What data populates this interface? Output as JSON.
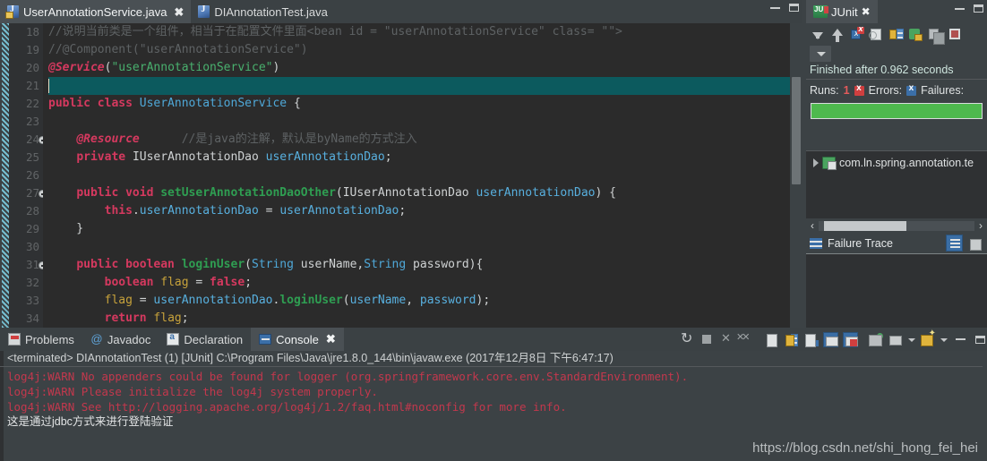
{
  "editor": {
    "tabs": [
      {
        "label": "UserAnnotationService.java",
        "active": true,
        "closeable": true,
        "icon": "java-file-lock-icon"
      },
      {
        "label": "DIAnnotationTest.java",
        "active": false,
        "closeable": false,
        "icon": "java-file-icon"
      }
    ],
    "window_controls": {
      "minimize": "minimize-icon",
      "maximize": "maximize-icon"
    },
    "first_line_number": 18,
    "lines": [
      {
        "n": 18,
        "fold": false,
        "tokens": [
          {
            "t": "//说明当前类是一个组件，相当于在配置文件里面<bean id = \"userAnnotationService\" class= \"\">",
            "c": "cmt"
          }
        ]
      },
      {
        "n": 19,
        "fold": false,
        "tokens": [
          {
            "t": "//@Component(\"userAnnotationService\")",
            "c": "cmt"
          }
        ]
      },
      {
        "n": 20,
        "fold": false,
        "tokens": [
          {
            "t": "@Service",
            "c": "ann"
          },
          {
            "t": "(",
            "c": "pl"
          },
          {
            "t": "\"userAnnotationService\"",
            "c": "str"
          },
          {
            "t": ")",
            "c": "pl"
          }
        ]
      },
      {
        "n": 21,
        "fold": false,
        "cursor": true,
        "tokens": [
          {
            "t": "",
            "c": "pl"
          }
        ]
      },
      {
        "n": 22,
        "fold": false,
        "tokens": [
          {
            "t": "public class ",
            "c": "kw"
          },
          {
            "t": "UserAnnotationService ",
            "c": "type"
          },
          {
            "t": "{",
            "c": "pl"
          }
        ]
      },
      {
        "n": 23,
        "fold": false,
        "tokens": [
          {
            "t": "",
            "c": "pl"
          }
        ]
      },
      {
        "n": 24,
        "fold": true,
        "tokens": [
          {
            "t": "    ",
            "c": "pl"
          },
          {
            "t": "@Resource",
            "c": "ann"
          },
          {
            "t": "      ",
            "c": "pl"
          },
          {
            "t": "//是java的注解，默认是byName的方式注入",
            "c": "cmt"
          }
        ]
      },
      {
        "n": 25,
        "fold": false,
        "tokens": [
          {
            "t": "    ",
            "c": "pl"
          },
          {
            "t": "private ",
            "c": "kw"
          },
          {
            "t": "IUserAnnotationDao ",
            "c": "pl"
          },
          {
            "t": "userAnnotationDao",
            "c": "fld"
          },
          {
            "t": ";",
            "c": "pl"
          }
        ]
      },
      {
        "n": 26,
        "fold": false,
        "tokens": [
          {
            "t": "",
            "c": "pl"
          }
        ]
      },
      {
        "n": 27,
        "fold": true,
        "tokens": [
          {
            "t": "    ",
            "c": "pl"
          },
          {
            "t": "public void ",
            "c": "kw"
          },
          {
            "t": "setUserAnnotationDaoOther",
            "c": "meth"
          },
          {
            "t": "(IUserAnnotationDao ",
            "c": "pl"
          },
          {
            "t": "userAnnotationDao",
            "c": "fld"
          },
          {
            "t": ") {",
            "c": "pl"
          }
        ]
      },
      {
        "n": 28,
        "fold": false,
        "tokens": [
          {
            "t": "        ",
            "c": "pl"
          },
          {
            "t": "this",
            "c": "kw"
          },
          {
            "t": ".",
            "c": "pl"
          },
          {
            "t": "userAnnotationDao",
            "c": "fld"
          },
          {
            "t": " = ",
            "c": "pl"
          },
          {
            "t": "userAnnotationDao",
            "c": "fld"
          },
          {
            "t": ";",
            "c": "pl"
          }
        ]
      },
      {
        "n": 29,
        "fold": false,
        "tokens": [
          {
            "t": "    }",
            "c": "pl"
          }
        ]
      },
      {
        "n": 30,
        "fold": false,
        "tokens": [
          {
            "t": "",
            "c": "pl"
          }
        ]
      },
      {
        "n": 31,
        "fold": true,
        "tokens": [
          {
            "t": "    ",
            "c": "pl"
          },
          {
            "t": "public boolean ",
            "c": "kw"
          },
          {
            "t": "loginUser",
            "c": "meth"
          },
          {
            "t": "(",
            "c": "pl"
          },
          {
            "t": "String ",
            "c": "type"
          },
          {
            "t": "userName,",
            "c": "pl"
          },
          {
            "t": "String ",
            "c": "type"
          },
          {
            "t": "password){",
            "c": "pl"
          }
        ]
      },
      {
        "n": 32,
        "fold": false,
        "tokens": [
          {
            "t": "        ",
            "c": "pl"
          },
          {
            "t": "boolean ",
            "c": "kw"
          },
          {
            "t": "flag",
            "c": "var"
          },
          {
            "t": " = ",
            "c": "pl"
          },
          {
            "t": "false",
            "c": "kw"
          },
          {
            "t": ";",
            "c": "pl"
          }
        ]
      },
      {
        "n": 33,
        "fold": false,
        "tokens": [
          {
            "t": "        ",
            "c": "pl"
          },
          {
            "t": "flag",
            "c": "var"
          },
          {
            "t": " = ",
            "c": "pl"
          },
          {
            "t": "userAnnotationDao",
            "c": "fld"
          },
          {
            "t": ".",
            "c": "pl"
          },
          {
            "t": "loginUser",
            "c": "meth"
          },
          {
            "t": "(",
            "c": "pl"
          },
          {
            "t": "userName",
            "c": "fld"
          },
          {
            "t": ", ",
            "c": "pl"
          },
          {
            "t": "password",
            "c": "fld"
          },
          {
            "t": ");",
            "c": "pl"
          }
        ]
      },
      {
        "n": 34,
        "fold": false,
        "tokens": [
          {
            "t": "        ",
            "c": "pl"
          },
          {
            "t": "return ",
            "c": "kw"
          },
          {
            "t": "flag",
            "c": "var"
          },
          {
            "t": ";",
            "c": "pl"
          }
        ]
      }
    ]
  },
  "junit": {
    "tab_label": "JUnit",
    "close_label": "✖",
    "toolbar_icons": [
      "next-failure-icon",
      "previous-failure-icon",
      "show-failures-only-icon",
      "stop-test-icon",
      "lock-scroll-icon",
      "rerun-test-icon",
      "rerun-failed-icon",
      "stop-icon"
    ],
    "view_menu": "view-menu-icon",
    "status": "Finished after 0.962 seconds",
    "counts": {
      "runs_label": "Runs:",
      "runs_value": "1",
      "errors_label": "Errors:",
      "errors_value": "",
      "failures_label": "Failures:",
      "failures_value": ""
    },
    "progress_color": "#4eb94e",
    "tree": [
      {
        "label": "com.ln.spring.annotation.te",
        "expandable": true
      }
    ],
    "failure_trace": {
      "title": "Failure Trace",
      "buttons": [
        "filter-stack-trace-icon",
        "copy-trace-icon"
      ],
      "body": ""
    },
    "window_controls": {
      "minimize": "minimize-icon",
      "maximize": "maximize-icon"
    },
    "hscroll": {
      "left": "‹",
      "right": "›"
    }
  },
  "bottom": {
    "tabs": [
      {
        "label": "Problems",
        "icon": "problems-icon",
        "active": false
      },
      {
        "label": "Javadoc",
        "icon": "javadoc-icon",
        "active": false
      },
      {
        "label": "Declaration",
        "icon": "declaration-icon",
        "active": false
      },
      {
        "label": "Console",
        "icon": "console-icon",
        "active": true,
        "closeable": true
      }
    ],
    "toolbar_icons": [
      "relaunch-icon",
      "terminate-icon",
      "remove-launch-icon",
      "remove-all-terminated-icon",
      "clear-console-icon",
      "scroll-lock-icon",
      "pin-console-icon",
      "display-selected-console-icon",
      "close-console-icon",
      "open-console-icon",
      "pin-icon",
      "new-console-view-icon"
    ],
    "window_controls": {
      "minimize": "minimize-icon",
      "maximize": "maximize-icon"
    },
    "console": {
      "terminated_line": "<terminated> DIAnnotationTest (1) [JUnit] C:\\Program Files\\Java\\jre1.8.0_144\\bin\\javaw.exe (2017年12月8日 下午6:47:17)",
      "lines": [
        {
          "text": "log4j:WARN No appenders could be found for logger (org.springframework.core.env.StandardEnvironment).",
          "style": "warn"
        },
        {
          "text": "log4j:WARN Please initialize the log4j system properly.",
          "style": "warn"
        },
        {
          "text": "log4j:WARN See http://logging.apache.org/log4j/1.2/faq.html#noconfig for more info.",
          "style": "warn"
        },
        {
          "text": "这是通过jdbc方式来进行登陆验证",
          "style": "plain"
        }
      ]
    }
  },
  "watermark": "https://blog.csdn.net/shi_hong_fei_hei"
}
